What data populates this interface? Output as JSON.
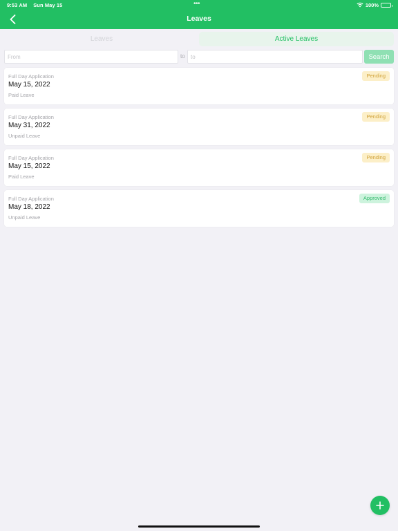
{
  "status_bar": {
    "time": "9:53 AM",
    "date": "Sun May 15",
    "battery": "100%",
    "dots": "•••"
  },
  "nav": {
    "title": "Leaves",
    "back_icon": "chevron-left-icon"
  },
  "tabs": [
    {
      "label": "Leaves",
      "active": false
    },
    {
      "label": "Active Leaves",
      "active": true
    }
  ],
  "filter": {
    "from_placeholder": "From",
    "to_separator": "to",
    "to_placeholder": "to",
    "search_label": "Search"
  },
  "leaves": [
    {
      "type": "Full Day Application",
      "date": "May 15, 2022",
      "kind": "Paid Leave",
      "status": "Pending"
    },
    {
      "type": "Full Day Application",
      "date": "May 31, 2022",
      "kind": "Unpaid Leave",
      "status": "Pending"
    },
    {
      "type": "Full Day Application",
      "date": "May 15, 2022",
      "kind": "Paid Leave",
      "status": "Pending"
    },
    {
      "type": "Full Day Application",
      "date": "May 18, 2022",
      "kind": "Unpaid Leave",
      "status": "Approved"
    }
  ],
  "fab_icon": "plus-icon",
  "colors": {
    "brand": "#22bf63",
    "pending_bg": "#fcefc8",
    "pending_text": "#d1a33b",
    "approved_bg": "#cdf3dd",
    "approved_text": "#34bb6d",
    "background": "#f2f1f6"
  }
}
